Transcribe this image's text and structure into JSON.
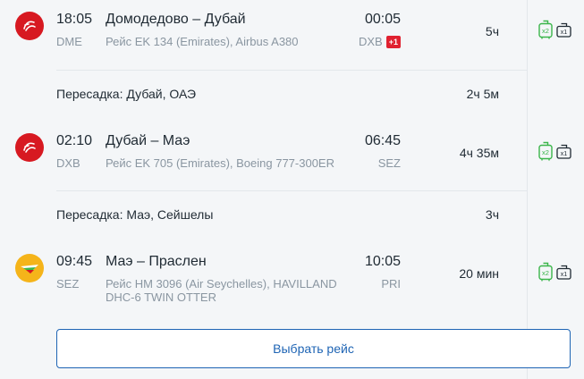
{
  "segments": [
    {
      "airline_icon": "emirates-logo",
      "dep_time": "18:05",
      "dep_code": "DME",
      "route": "Домодедово – Дубай",
      "flight_info": "Рейс EK 134 (Emirates), Airbus A380",
      "arr_time": "00:05",
      "arr_code": "DXB",
      "day_offset": "+1",
      "duration": "5ч",
      "baggage_count": "x2",
      "hand_luggage_count": "x1"
    },
    {
      "airline_icon": "emirates-logo",
      "dep_time": "02:10",
      "dep_code": "DXB",
      "route": "Дубай – Маэ",
      "flight_info": "Рейс EK 705 (Emirates), Boeing 777-300ER",
      "arr_time": "06:45",
      "arr_code": "SEZ",
      "duration": "4ч 35м",
      "baggage_count": "x2",
      "hand_luggage_count": "x1"
    },
    {
      "airline_icon": "air-seychelles-logo",
      "dep_time": "09:45",
      "dep_code": "SEZ",
      "route": "Маэ – Праслен",
      "flight_info": "Рейс HM 3096 (Air Seychelles), HAVILLAND DHC-6 TWIN OTTER",
      "arr_time": "10:05",
      "arr_code": "PRI",
      "duration": "20 мин",
      "baggage_count": "x2",
      "hand_luggage_count": "x1"
    }
  ],
  "transfers": [
    {
      "label": "Пересадка: Дубай, ОАЭ",
      "duration": "2ч 5м"
    },
    {
      "label": "Пересадка: Маэ, Сейшелы",
      "duration": "3ч"
    }
  ],
  "select_button": "Выбрать рейс",
  "colors": {
    "emirates_red": "#d71921",
    "air_seychelles_yellow": "#f5b41a",
    "baggage_green": "#3ab54a",
    "link_blue": "#1e64b4",
    "badge_red": "#e02130"
  }
}
